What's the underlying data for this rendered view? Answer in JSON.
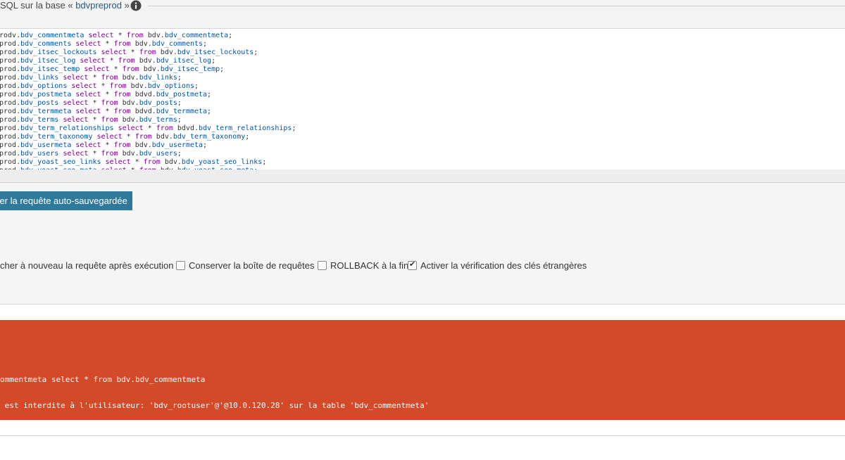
{
  "legend": {
    "prefix": "SQL sur la base « ",
    "db_name": "bdvpreprod",
    "suffix": " » :"
  },
  "icons": {
    "info": "info-icon"
  },
  "code_lines": [
    [
      [
        "ident",
        "rodv."
      ],
      [
        "var",
        "bdv_commentmeta"
      ],
      [
        "kw",
        " select "
      ],
      [
        "ident",
        "* "
      ],
      [
        "kw",
        "from "
      ],
      [
        "ident",
        "bdv."
      ],
      [
        "var",
        "bdv_commentmeta"
      ],
      [
        "ident",
        ";"
      ]
    ],
    [
      [
        "ident",
        "prod."
      ],
      [
        "var",
        "bdv_comments"
      ],
      [
        "kw",
        " select "
      ],
      [
        "ident",
        "* "
      ],
      [
        "kw",
        "from "
      ],
      [
        "ident",
        "bdv."
      ],
      [
        "var",
        "bdv_comments"
      ],
      [
        "ident",
        ";"
      ]
    ],
    [
      [
        "ident",
        "prod."
      ],
      [
        "var",
        "bdv_itsec_lockouts"
      ],
      [
        "kw",
        " select "
      ],
      [
        "ident",
        "* "
      ],
      [
        "kw",
        "from "
      ],
      [
        "ident",
        "bdv."
      ],
      [
        "var",
        "bdv_itsec_lockouts"
      ],
      [
        "ident",
        ";"
      ]
    ],
    [
      [
        "ident",
        "prod."
      ],
      [
        "var",
        "bdv_itsec_log"
      ],
      [
        "kw",
        " select "
      ],
      [
        "ident",
        "* "
      ],
      [
        "kw",
        "from "
      ],
      [
        "ident",
        "bdv."
      ],
      [
        "var",
        "bdv_itsec_log"
      ],
      [
        "ident",
        ";"
      ]
    ],
    [
      [
        "ident",
        "prod."
      ],
      [
        "var",
        "bdv_itsec_temp"
      ],
      [
        "kw",
        " select "
      ],
      [
        "ident",
        "* "
      ],
      [
        "kw",
        "from "
      ],
      [
        "ident",
        "bdv."
      ],
      [
        "var",
        "bdv_itsec_temp"
      ],
      [
        "ident",
        ";"
      ]
    ],
    [
      [
        "ident",
        "prod."
      ],
      [
        "var",
        "bdv_links"
      ],
      [
        "kw",
        " select "
      ],
      [
        "ident",
        "* "
      ],
      [
        "kw",
        "from "
      ],
      [
        "ident",
        "bdv."
      ],
      [
        "var",
        "bdv_links"
      ],
      [
        "ident",
        ";"
      ]
    ],
    [
      [
        "ident",
        "prod."
      ],
      [
        "var",
        "bdv_options"
      ],
      [
        "kw",
        " select "
      ],
      [
        "ident",
        "* "
      ],
      [
        "kw",
        "from "
      ],
      [
        "ident",
        "bdv."
      ],
      [
        "var",
        "bdv_options"
      ],
      [
        "ident",
        ";"
      ]
    ],
    [
      [
        "ident",
        "prod."
      ],
      [
        "var",
        "bdv_postmeta"
      ],
      [
        "kw",
        " select "
      ],
      [
        "ident",
        "* "
      ],
      [
        "kw",
        "from "
      ],
      [
        "ident",
        "bdvd."
      ],
      [
        "var",
        "bdv_postmeta"
      ],
      [
        "ident",
        ";"
      ]
    ],
    [
      [
        "ident",
        "prod."
      ],
      [
        "var",
        "bdv_posts"
      ],
      [
        "kw",
        " select "
      ],
      [
        "ident",
        "* "
      ],
      [
        "kw",
        "from "
      ],
      [
        "ident",
        "bdv."
      ],
      [
        "var",
        "bdv_posts"
      ],
      [
        "ident",
        ";"
      ]
    ],
    [
      [
        "ident",
        "prod."
      ],
      [
        "var",
        "bdv_termmeta"
      ],
      [
        "kw",
        " select "
      ],
      [
        "ident",
        "* "
      ],
      [
        "kw",
        "from "
      ],
      [
        "ident",
        "bdvd."
      ],
      [
        "var",
        "bdv_termmeta"
      ],
      [
        "ident",
        ";"
      ]
    ],
    [
      [
        "ident",
        "prod."
      ],
      [
        "var",
        "bdv_terms"
      ],
      [
        "kw",
        " select "
      ],
      [
        "ident",
        "* "
      ],
      [
        "kw",
        "from "
      ],
      [
        "ident",
        "bdv."
      ],
      [
        "var",
        "bdv_terms"
      ],
      [
        "ident",
        ";"
      ]
    ],
    [
      [
        "ident",
        "prod."
      ],
      [
        "var",
        "bdv_term_relationships"
      ],
      [
        "kw",
        " select "
      ],
      [
        "ident",
        "* "
      ],
      [
        "kw",
        "from "
      ],
      [
        "ident",
        "bdvd."
      ],
      [
        "var",
        "bdv_term_relationships"
      ],
      [
        "ident",
        ";"
      ]
    ],
    [
      [
        "ident",
        "prod."
      ],
      [
        "var",
        "bdv_term_taxonomy"
      ],
      [
        "kw",
        " select "
      ],
      [
        "ident",
        "* "
      ],
      [
        "kw",
        "from "
      ],
      [
        "ident",
        "bdv."
      ],
      [
        "var",
        "bdv_term_taxonomy"
      ],
      [
        "ident",
        ";"
      ]
    ],
    [
      [
        "ident",
        "prod."
      ],
      [
        "var",
        "bdv_usermeta"
      ],
      [
        "kw",
        " select "
      ],
      [
        "ident",
        "* "
      ],
      [
        "kw",
        "from "
      ],
      [
        "ident",
        "bdv."
      ],
      [
        "var",
        "bdv_usermeta"
      ],
      [
        "ident",
        ";"
      ]
    ],
    [
      [
        "ident",
        "prod."
      ],
      [
        "var",
        "bdv_users"
      ],
      [
        "kw",
        " select "
      ],
      [
        "ident",
        "* "
      ],
      [
        "kw",
        "from "
      ],
      [
        "ident",
        "bdv."
      ],
      [
        "var",
        "bdv_users"
      ],
      [
        "ident",
        ";"
      ]
    ],
    [
      [
        "ident",
        "prod."
      ],
      [
        "var",
        "bdv_yoast_seo_links"
      ],
      [
        "kw",
        " select "
      ],
      [
        "ident",
        "* "
      ],
      [
        "kw",
        "from "
      ],
      [
        "ident",
        "bdv."
      ],
      [
        "var",
        "bdv_yoast_seo_links"
      ],
      [
        "ident",
        ";"
      ]
    ],
    [
      [
        "ident",
        "prod."
      ],
      [
        "var",
        "bdv_yoast_seo_meta"
      ],
      [
        "kw",
        " select "
      ],
      [
        "ident",
        "* "
      ],
      [
        "kw",
        "from "
      ],
      [
        "ident",
        "bdv."
      ],
      [
        "var",
        "bdv_yoast_seo_meta"
      ],
      [
        "ident",
        ";"
      ]
    ]
  ],
  "retrieve_button": {
    "label": "rer la requête auto-sauvegardée"
  },
  "options": [
    {
      "label": "cher à nouveau la requête après exécution",
      "has_checkbox": false,
      "checked": false
    },
    {
      "label": "Conserver la boîte de requêtes",
      "has_checkbox": true,
      "checked": false
    },
    {
      "label": "ROLLBACK à la fin",
      "has_checkbox": true,
      "checked": false
    },
    {
      "label": "Activer la vérification des clés étrangères",
      "has_checkbox": true,
      "checked": true
    }
  ],
  "error": {
    "query": "ommentmeta select * from bdv.bdv_commentmeta",
    "message": " est interdite à l'utilisateur: 'bdv_rootuser'@'@10.0.120.28' sur la table 'bdv_commentmeta'"
  },
  "colors": {
    "error_bg": "#d44a29",
    "button_bg": "#2f7a9a",
    "keyword": "#770088",
    "variable": "#05a",
    "link": "#235a81"
  }
}
